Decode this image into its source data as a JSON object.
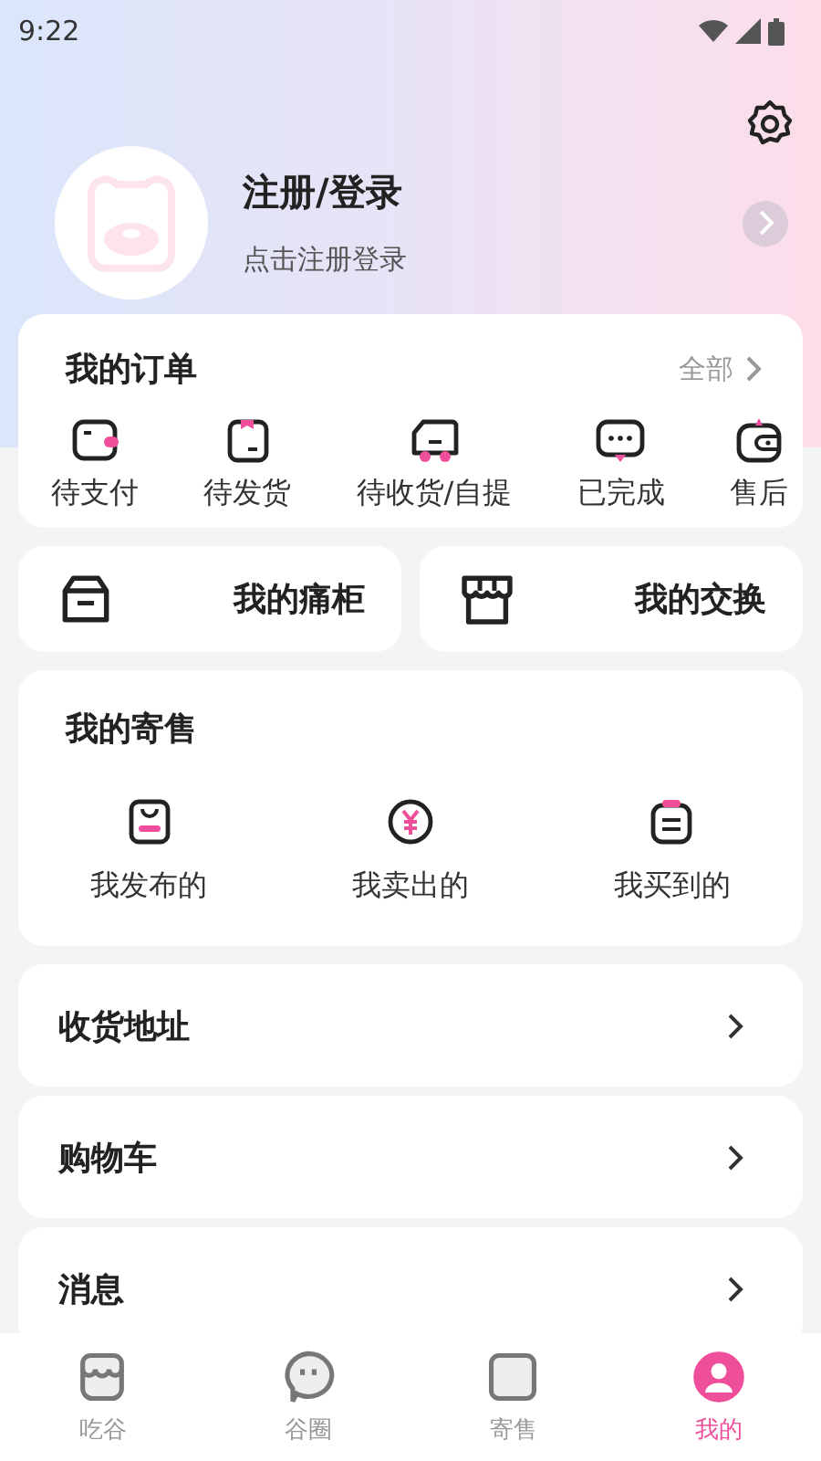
{
  "status_bar": {
    "time": "9:22"
  },
  "profile": {
    "title": "注册/登录",
    "subtitle": "点击注册登录"
  },
  "orders": {
    "title": "我的订单",
    "more": "全部",
    "items": [
      {
        "label": "待支付",
        "kind": "wallet"
      },
      {
        "label": "待发货",
        "kind": "box"
      },
      {
        "label": "待收货/自提",
        "kind": "truck"
      },
      {
        "label": "已完成",
        "kind": "chat"
      },
      {
        "label": "售后",
        "kind": "purse"
      }
    ]
  },
  "shortcuts": [
    {
      "label": "我的痛柜",
      "kind": "cabinet"
    },
    {
      "label": "我的交换",
      "kind": "shop"
    }
  ],
  "consign": {
    "title": "我的寄售",
    "items": [
      {
        "label": "我发布的",
        "kind": "bag"
      },
      {
        "label": "我卖出的",
        "kind": "yen"
      },
      {
        "label": "我买到的",
        "kind": "clipboard"
      }
    ]
  },
  "rows": [
    {
      "label": "收货地址"
    },
    {
      "label": "购物车"
    },
    {
      "label": "消息"
    }
  ],
  "tabs": [
    {
      "label": "吃谷",
      "kind": "shop",
      "selected": false
    },
    {
      "label": "谷圈",
      "kind": "chat",
      "selected": false
    },
    {
      "label": "寄售",
      "kind": "box",
      "selected": false
    },
    {
      "label": "我的",
      "kind": "user",
      "selected": true
    }
  ]
}
